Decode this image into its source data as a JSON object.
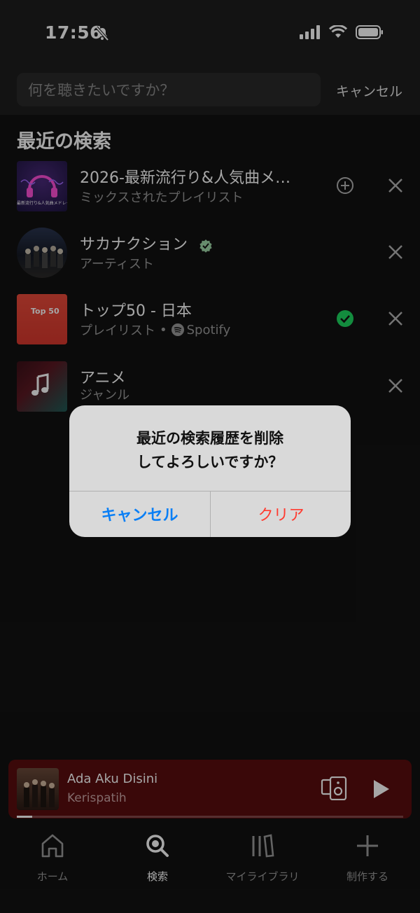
{
  "status_bar": {
    "time": "17:56"
  },
  "search": {
    "placeholder": "何を聴きたいですか？",
    "cancel_label": "キャンセル"
  },
  "recent_title": "最近の検索",
  "items": [
    {
      "title": "2026-最新流行り&人気曲メ…",
      "subtitle": "ミックスされたプレイリスト",
      "thumb_text": "最新流行り&人気曲メドレー",
      "action": "add"
    },
    {
      "title": "サカナクション",
      "subtitle": "アーティスト",
      "verified": true
    },
    {
      "title": "トップ50 - 日本",
      "subtitle_type": "プレイリスト",
      "subtitle_owner": "Spotify",
      "thumb_text": "Top 50",
      "action": "added"
    },
    {
      "title": "アニメ",
      "subtitle": "ジャンル"
    }
  ],
  "dialog": {
    "message_line1": "最近の検索履歴を削除",
    "message_line2": "してよろしいですか？",
    "cancel_label": "キャンセル",
    "clear_label": "クリア"
  },
  "now_playing": {
    "title": "Ada Aku Disini",
    "artist": "Kerispatih",
    "progress": 0.04
  },
  "nav": [
    {
      "label": "ホーム",
      "icon": "home-icon"
    },
    {
      "label": "検索",
      "icon": "search-icon",
      "active": true
    },
    {
      "label": "マイライブラリ",
      "icon": "library-icon"
    },
    {
      "label": "制作する",
      "icon": "plus-icon"
    }
  ],
  "colors": {
    "background": "#121212",
    "accent_green": "#1ed760",
    "player_bg": "#5a0d0f",
    "dialog_cancel": "#0a7ff5",
    "dialog_clear": "#ff3b30"
  }
}
